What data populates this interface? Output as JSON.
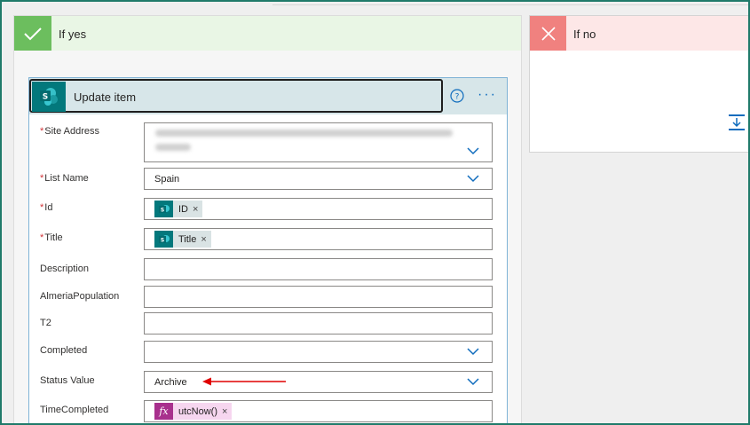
{
  "branches": {
    "yes": {
      "title": "If yes"
    },
    "no": {
      "title": "If no"
    }
  },
  "card": {
    "title": "Update item",
    "fields": {
      "site_address": {
        "label": "Site Address",
        "required": true
      },
      "list_name": {
        "label": "List Name",
        "required": true,
        "value": "Spain"
      },
      "id": {
        "label": "Id",
        "required": true,
        "token": "ID"
      },
      "title": {
        "label": "Title",
        "required": true,
        "token": "Title"
      },
      "description": {
        "label": "Description",
        "value": ""
      },
      "almeria_population": {
        "label": "AlmeriaPopulation",
        "value": ""
      },
      "t2": {
        "label": "T2",
        "value": ""
      },
      "completed": {
        "label": "Completed",
        "value": ""
      },
      "status_value": {
        "label": "Status Value",
        "value": "Archive"
      },
      "time_completed": {
        "label": "TimeCompleted",
        "token": "utcNow()",
        "token_icon": "fx"
      }
    },
    "required_marker": "*",
    "remove_glyph": "×",
    "more_glyph": "···"
  },
  "colors": {
    "yes_accent": "#6cbe5e",
    "no_accent": "#f0817f",
    "sharepoint": "#03787c",
    "expression": "#a8308d",
    "annotation_arrow": "#e00000"
  },
  "icons": [
    "check-icon",
    "close-icon",
    "sharepoint-icon",
    "help-icon",
    "more-icon",
    "chevron-down-icon",
    "expression-icon",
    "add-action-icon",
    "red-arrow-icon"
  ]
}
